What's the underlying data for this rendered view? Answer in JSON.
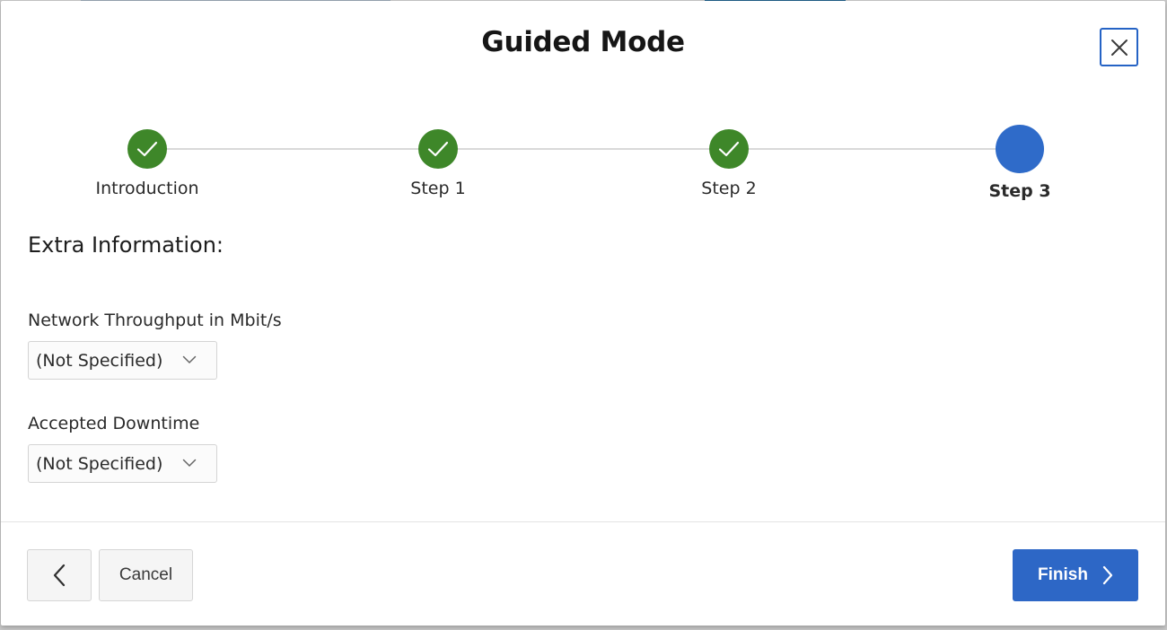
{
  "dialog": {
    "title": "Guided Mode",
    "close_icon": "close-icon"
  },
  "colors": {
    "completed": "#3e8729",
    "current": "#2f6bc9",
    "primary_button": "#2d67c6"
  },
  "progress": {
    "steps": [
      {
        "label": "Introduction",
        "status": "completed",
        "icon": "check-icon"
      },
      {
        "label": "Step 1",
        "status": "completed",
        "icon": "check-icon"
      },
      {
        "label": "Step 2",
        "status": "completed",
        "icon": "check-icon"
      },
      {
        "label": "Step 3",
        "status": "current"
      }
    ]
  },
  "form": {
    "heading": "Extra Information:",
    "fields": [
      {
        "label": "Network Throughput in Mbit/s",
        "value": "(Not Specified)",
        "icon": "chevron-down-icon"
      },
      {
        "label": "Accepted Downtime",
        "value": "(Not Specified)",
        "icon": "chevron-down-icon"
      }
    ]
  },
  "footer": {
    "back_icon": "chevron-left-icon",
    "cancel_label": "Cancel",
    "finish_label": "Finish",
    "finish_icon": "chevron-right-icon"
  }
}
